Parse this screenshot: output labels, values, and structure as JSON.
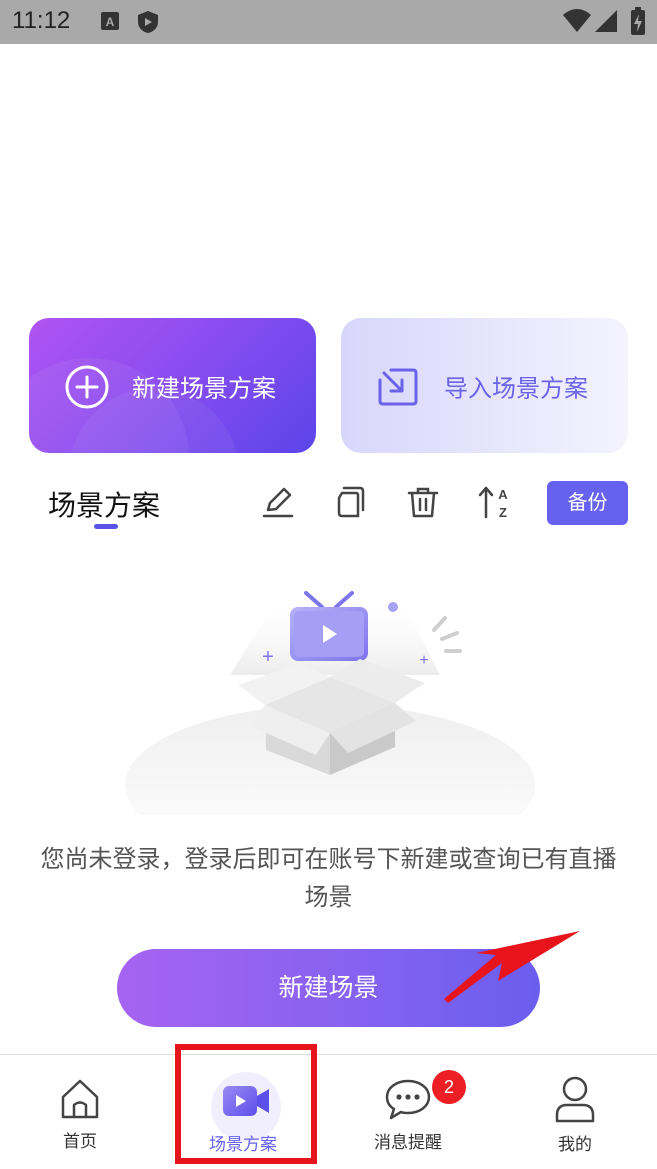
{
  "status_bar": {
    "time": "11:12"
  },
  "actions": {
    "new_plan_label": "新建场景方案",
    "import_plan_label": "导入场景方案"
  },
  "toolbar": {
    "title": "场景方案",
    "backup_label": "备份"
  },
  "empty_state": {
    "message": "您尚未登录，登录后即可在账号下新建或查询已有直播场景",
    "button_label": "新建场景"
  },
  "tabs": [
    {
      "label": "首页",
      "icon": "home-icon"
    },
    {
      "label": "场景方案",
      "icon": "video-camera-icon",
      "active": true
    },
    {
      "label": "消息提醒",
      "icon": "chat-bubble-icon",
      "badge": "2"
    },
    {
      "label": "我的",
      "icon": "user-icon"
    }
  ],
  "colors": {
    "accent": "#6661ee",
    "badge": "#ee1f24",
    "annotation": "#e8141c"
  }
}
